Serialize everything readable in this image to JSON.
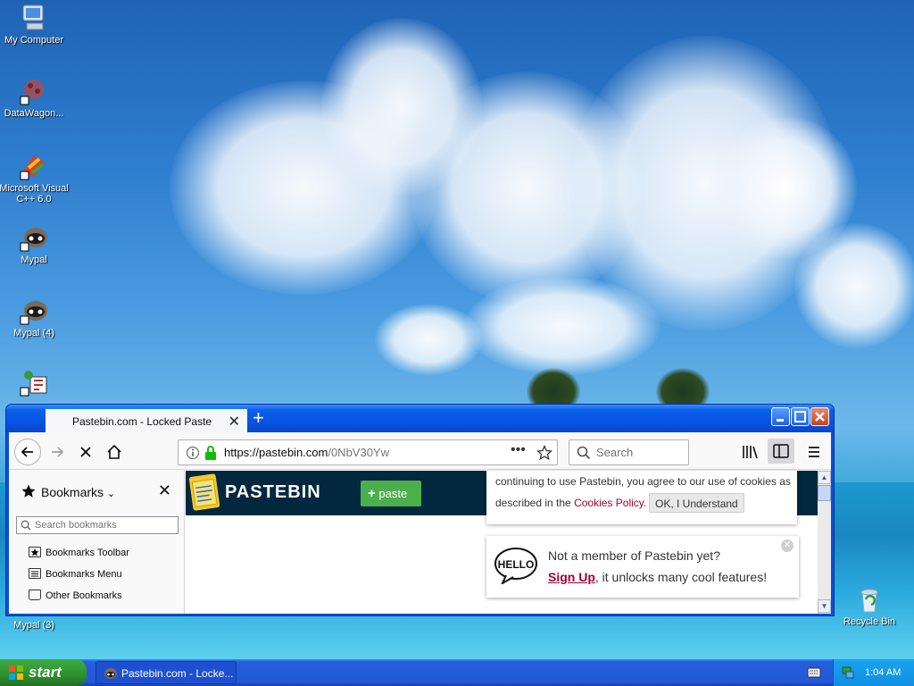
{
  "desktop": {
    "icons": [
      {
        "label": "My Computer"
      },
      {
        "label": "DataWagon..."
      },
      {
        "label": "Microsoft Visual C++ 6.0"
      },
      {
        "label": "Mypal"
      },
      {
        "label": "Mypal (4)"
      },
      {
        "label": "Mypal (3)"
      },
      {
        "label": "Recycle Bin"
      }
    ]
  },
  "browser": {
    "tab_title": "Pastebin.com - Locked Paste",
    "url_host": "https://pastebin.com",
    "url_path": "/0NbV30Yw",
    "search_placeholder": "Search"
  },
  "sidebar": {
    "title": "Bookmarks",
    "search_placeholder": "Search bookmarks",
    "items": [
      "Bookmarks Toolbar",
      "Bookmarks Menu",
      "Other Bookmarks"
    ]
  },
  "page": {
    "logo_text": "PASTEBIN",
    "paste_button": "paste",
    "cookie_text_1": "continuing to use Pastebin, you agree to our use of cookies as",
    "cookie_text_2": "described in the",
    "cookie_link": "Cookies Policy",
    "cookie_ok": "OK, I Understand",
    "member_question": "Not a member of Pastebin yet?",
    "signup_link": "Sign Up",
    "member_rest": ", it unlocks many cool features!",
    "hello_badge": "HELLO"
  },
  "taskbar": {
    "start_label": "start",
    "task_label": "Pastebin.com - Locke...",
    "clock": "1:04 AM"
  },
  "colors": {
    "pastebin_header": "#02283f",
    "paste_green": "#4cae4c",
    "link_red": "#a00130",
    "xp_blue": "#0852e0"
  }
}
